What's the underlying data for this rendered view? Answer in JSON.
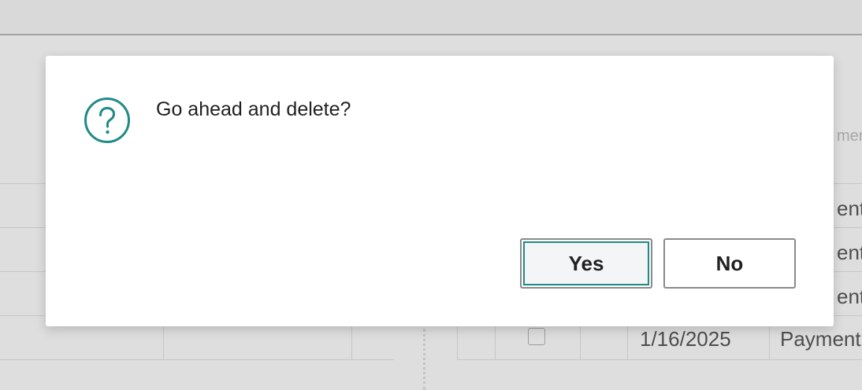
{
  "dialog": {
    "icon": "question-circle-icon",
    "message": "Go ahead and delete?",
    "buttons": {
      "yes_label": "Yes",
      "no_label": "No"
    }
  },
  "background": {
    "column_header_partial": "ment",
    "rows": [
      {
        "type": "ent"
      },
      {
        "type": "ent"
      },
      {
        "type": "ent"
      },
      {
        "date": "1/16/2025",
        "type": "Payment"
      }
    ]
  },
  "colors": {
    "accent": "#1f8a86",
    "dialog_background": "#ffffff",
    "overlay": "#dadada"
  }
}
